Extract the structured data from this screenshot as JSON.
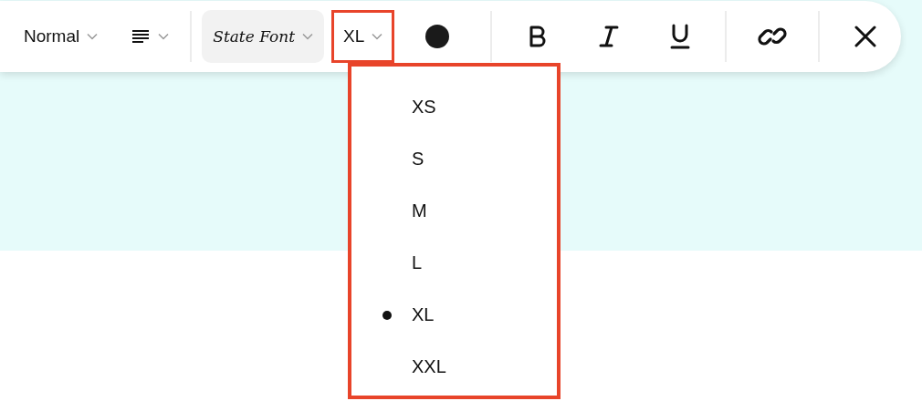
{
  "toolbar": {
    "style": {
      "label": "Normal"
    },
    "font": {
      "label": "State Font"
    },
    "size": {
      "label": "XL",
      "annotated": true
    }
  },
  "size_menu": {
    "annotated": true,
    "items": [
      {
        "label": "XS",
        "selected": false
      },
      {
        "label": "S",
        "selected": false
      },
      {
        "label": "M",
        "selected": false
      },
      {
        "label": "L",
        "selected": false
      },
      {
        "label": "XL",
        "selected": true
      },
      {
        "label": "XXL",
        "selected": false
      }
    ]
  }
}
